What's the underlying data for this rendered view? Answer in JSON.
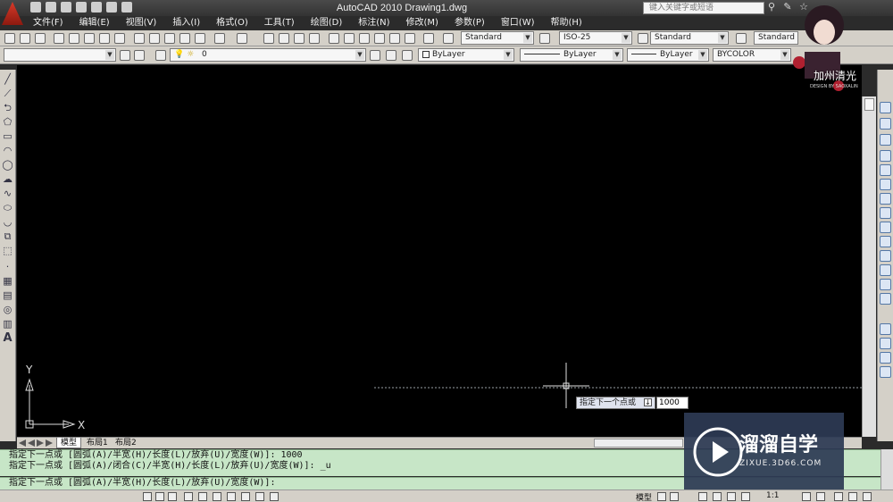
{
  "window": {
    "title": "AutoCAD 2010    Drawing1.dwg",
    "search_placeholder": "键入关键字或短语"
  },
  "menu": [
    "文件(F)",
    "编辑(E)",
    "视图(V)",
    "插入(I)",
    "格式(O)",
    "工具(T)",
    "绘图(D)",
    "标注(N)",
    "修改(M)",
    "参数(P)",
    "窗口(W)",
    "帮助(H)"
  ],
  "styles": {
    "text_style": "Standard",
    "dim_style": "ISO-25",
    "table_style": "Standard",
    "multileader_style": "Standard"
  },
  "layers": {
    "current_layer": "0",
    "color": "ByLayer",
    "linetype": "ByLayer",
    "lineweight": "ByLayer",
    "plot_style": "BYCOLOR"
  },
  "canvas": {
    "ucs_y": "Y",
    "ucs_x": "X",
    "tooltip_prompt": "指定下一个点或",
    "tooltip_value": "1000"
  },
  "layout_tabs": [
    "模型",
    "布局1",
    "布局2"
  ],
  "command": {
    "history": [
      "指定下一点或 [圆弧(A)/半宽(H)/长度(L)/放弃(U)/宽度(W)]: 1000",
      "指定下一点或 [圆弧(A)/闭合(C)/半宽(H)/长度(L)/放弃(U)/宽度(W)]: _u"
    ],
    "prompt": "指定下一点或 [圆弧(A)/半宽(H)/长度(L)/放弃(U)/宽度(W)]:"
  },
  "status": {
    "model_label": "模型",
    "scale": "1:1"
  },
  "watermark": {
    "brand": "溜溜自学",
    "url": "ZIXUE.3D66.COM"
  },
  "avatar": {
    "caption": "加州清光",
    "credit": "DESIGN BY SAOXALIN"
  }
}
